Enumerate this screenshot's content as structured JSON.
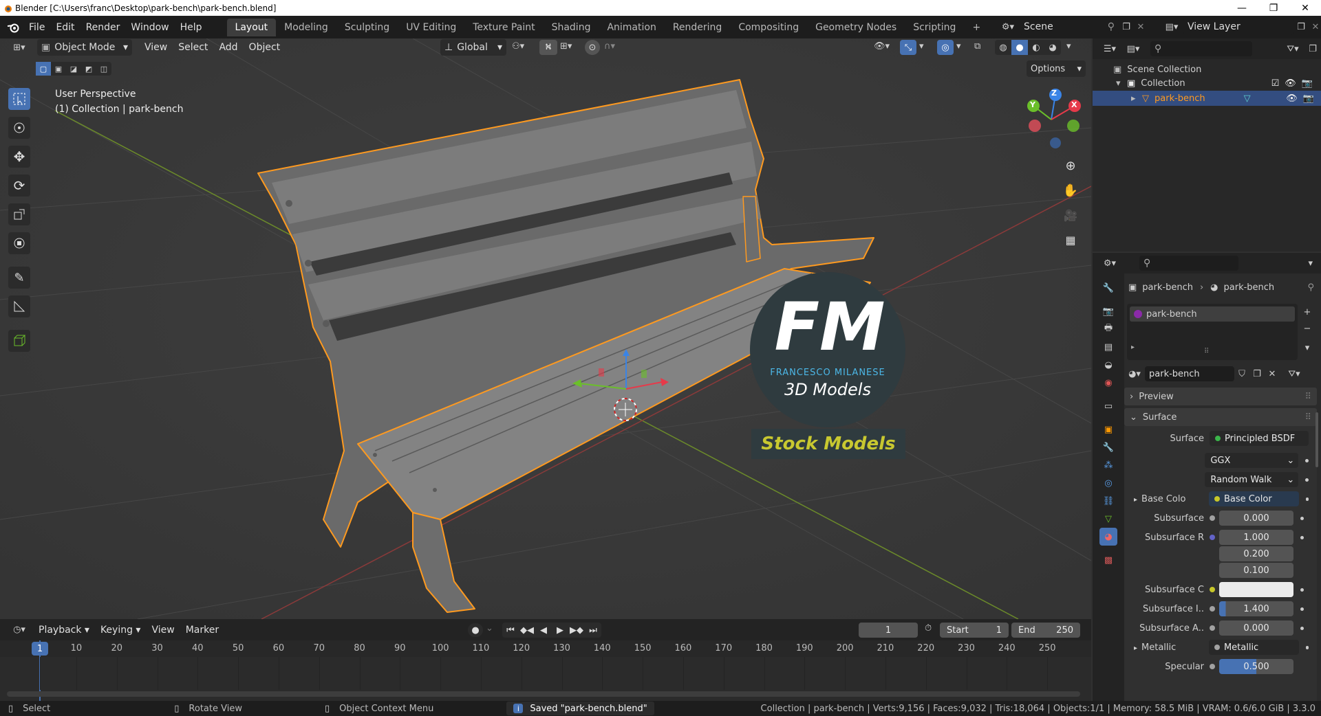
{
  "titlebar": {
    "title": "Blender [C:\\Users\\franc\\Desktop\\park-bench\\park-bench.blend]",
    "minimize": "—",
    "maximize": "❐",
    "close": "✕"
  },
  "menu": {
    "items": [
      "File",
      "Edit",
      "Render",
      "Window",
      "Help"
    ]
  },
  "workspaces": {
    "tabs": [
      "Layout",
      "Modeling",
      "Sculpting",
      "UV Editing",
      "Texture Paint",
      "Shading",
      "Animation",
      "Rendering",
      "Compositing",
      "Geometry Nodes",
      "Scripting"
    ],
    "active": "Layout",
    "add": "+"
  },
  "scene": {
    "label": "Scene",
    "view_layer": "View Layer"
  },
  "viewport_header": {
    "mode": "Object Mode",
    "menus": [
      "View",
      "Select",
      "Add",
      "Object"
    ],
    "transform": "Global",
    "options": "Options"
  },
  "viewport": {
    "perspective": "User Perspective",
    "collection_info": "(1) Collection | park-bench"
  },
  "watermark": {
    "line1": "FM",
    "brand": "FRANCESCO MILANESE",
    "subtitle": "3D Models",
    "banner": "Stock Models"
  },
  "gizmo": {
    "z": "Z",
    "y": "Y",
    "x": "X"
  },
  "outliner": {
    "scene_collection": "Scene Collection",
    "collection": "Collection",
    "object": "park-bench"
  },
  "properties": {
    "breadcrumb_obj": "park-bench",
    "breadcrumb_mat": "park-bench",
    "slot": "park-bench",
    "material": "park-bench",
    "preview": "Preview",
    "surface_panel": "Surface",
    "rows": [
      {
        "label": "Surface",
        "value": "Principled BSDF",
        "dot": "#3bb54a"
      },
      {
        "label": "",
        "value": "GGX"
      },
      {
        "label": "",
        "value": "Random Walk"
      },
      {
        "label": "Base Colo",
        "value": "Base Color",
        "dot": "#c7c729"
      },
      {
        "label": "Subsurface",
        "value": "0.000"
      },
      {
        "label": "Subsurface R",
        "value": "1.000"
      },
      {
        "label": "",
        "value": "0.200"
      },
      {
        "label": "",
        "value": "0.100"
      },
      {
        "label": "Subsurface C",
        "value": ""
      },
      {
        "label": "Subsurface I..",
        "value": "1.400"
      },
      {
        "label": "Subsurface A..",
        "value": "0.000"
      },
      {
        "label": "Metallic",
        "value": "Metallic"
      },
      {
        "label": "Specular",
        "value": "0.500"
      }
    ]
  },
  "timeline": {
    "menus": [
      "Playback",
      "Keying",
      "View",
      "Marker"
    ],
    "current": "1",
    "start_label": "Start",
    "start": "1",
    "end_label": "End",
    "end": "250",
    "frames": [
      "1",
      "10",
      "20",
      "30",
      "40",
      "50",
      "60",
      "70",
      "80",
      "90",
      "100",
      "110",
      "120",
      "130",
      "140",
      "150",
      "160",
      "170",
      "180",
      "190",
      "200",
      "210",
      "220",
      "230",
      "240",
      "250"
    ]
  },
  "status": {
    "select": "Select",
    "rotate": "Rotate View",
    "context": "Object Context Menu",
    "saved": "Saved \"park-bench.blend\"",
    "stats": "Collection | park-bench | Verts:9,156 | Faces:9,032 | Tris:18,064 | Objects:1/1 | Memory: 58.5 MiB | VRAM: 0.6/6.0 GiB | 3.3.0"
  },
  "colors": {
    "accent": "#4772b3",
    "selection": "#ff9a1f",
    "header": "#1d1d1d",
    "viewport": "#3a3a3a"
  }
}
